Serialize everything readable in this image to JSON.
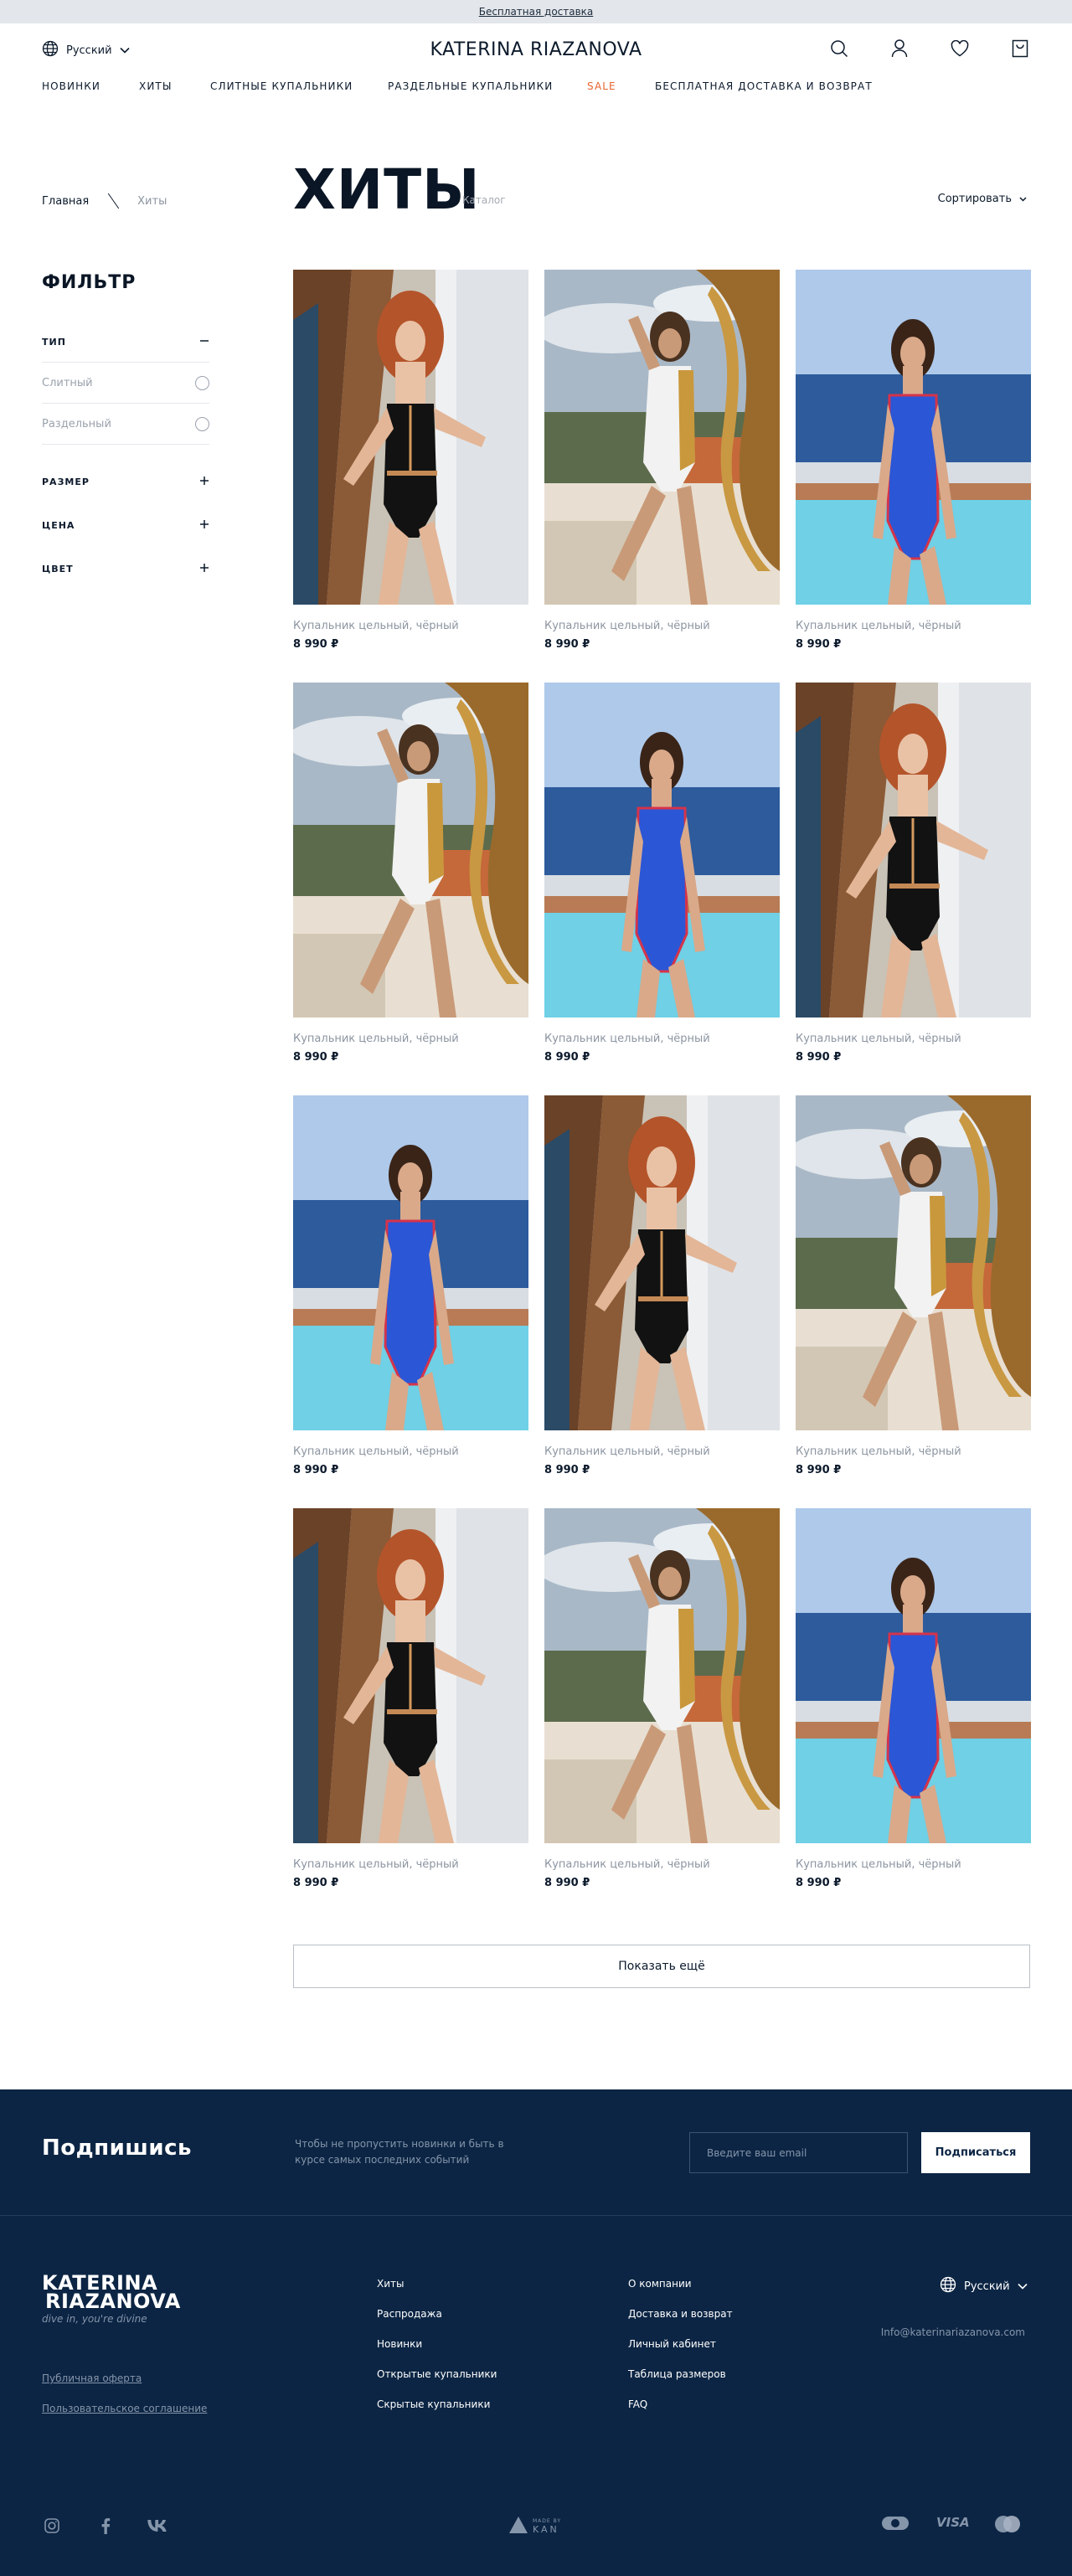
{
  "promo": {
    "text": "Бесплатная доставка"
  },
  "header": {
    "language": "Русский",
    "logo": "KATERINA RIAZANOVA",
    "icons": [
      "search-icon",
      "user-icon",
      "heart-icon",
      "bag-icon"
    ]
  },
  "nav": [
    {
      "label": "НОВИНКИ"
    },
    {
      "label": "ХИТЫ"
    },
    {
      "label": "СЛИТНЫЕ КУПАЛЬНИКИ"
    },
    {
      "label": "РАЗДЕЛЬНЫЕ КУПАЛЬНИКИ"
    },
    {
      "label": "SALE",
      "accent": "#e8642e"
    },
    {
      "label": "БЕСПЛАТНАЯ ДОСТАВКА И ВОЗВРАТ"
    }
  ],
  "breadcrumbs": [
    "Главная",
    "Хиты"
  ],
  "page": {
    "title": "ХИТЫ",
    "subtitle": "Каталог",
    "sort_label": "Сортировать"
  },
  "filter": {
    "title": "ФИЛЬТР",
    "type": {
      "label": "ТИП",
      "options": [
        "Слитный",
        "Раздельный"
      ]
    },
    "size": "РАЗМЕР",
    "price": "ЦЕНА",
    "color": "ЦВЕТ"
  },
  "products": [
    {
      "name": "Купальник цельный, чёрный",
      "price": "8 990 ₽",
      "photo": "black"
    },
    {
      "name": "Купальник цельный, чёрный",
      "price": "8 990 ₽",
      "photo": "white-gold"
    },
    {
      "name": "Купальник цельный, чёрный",
      "price": "8 990 ₽",
      "photo": "blue"
    },
    {
      "name": "Купальник цельный, чёрный",
      "price": "8 990 ₽",
      "photo": "white-gold"
    },
    {
      "name": "Купальник цельный, чёрный",
      "price": "8 990 ₽",
      "photo": "blue"
    },
    {
      "name": "Купальник цельный, чёрный",
      "price": "8 990 ₽",
      "photo": "black"
    },
    {
      "name": "Купальник цельный, чёрный",
      "price": "8 990 ₽",
      "photo": "blue"
    },
    {
      "name": "Купальник цельный, чёрный",
      "price": "8 990 ₽",
      "photo": "black"
    },
    {
      "name": "Купальник цельный, чёрный",
      "price": "8 990 ₽",
      "photo": "white-gold"
    },
    {
      "name": "Купальник цельный, чёрный",
      "price": "8 990 ₽",
      "photo": "black"
    },
    {
      "name": "Купальник цельный, чёрный",
      "price": "8 990 ₽",
      "photo": "white-gold"
    },
    {
      "name": "Купальник цельный, чёрный",
      "price": "8 990 ₽",
      "photo": "blue"
    }
  ],
  "show_more": "Показать ещё",
  "footer": {
    "subscribe_title": "Подпишись",
    "subscribe_note": "Чтобы не пропустить новинки и быть в курсе самых последних событий",
    "email_placeholder": "Введите ваш email",
    "subscribe_button": "Подписаться",
    "logo_line1": "KATERINA",
    "logo_line2": "RIAZANOVA",
    "tagline": "dive in, you're divine",
    "legal": [
      "Публичная оферта",
      "Пользовательское соглашение"
    ],
    "col1": [
      "Хиты",
      "Распродажа",
      "Новинки",
      "Открытые купальники",
      "Скрытые купальники"
    ],
    "col2": [
      "О компании",
      "Доставка и возврат",
      "Личный кабинет",
      "Таблица размеров",
      "FAQ"
    ],
    "language": "Русский",
    "email": "Info@katerinariazanova.com",
    "social": [
      "instagram-icon",
      "facebook-icon",
      "vk-icon"
    ],
    "made_by_label": "MADE BY",
    "made_by": "KAN",
    "payments": [
      "mir",
      "VISA",
      "mastercard"
    ]
  },
  "colors": {
    "navy": "#0c2544",
    "sale": "#e8642e",
    "muted": "#8c95a1"
  }
}
